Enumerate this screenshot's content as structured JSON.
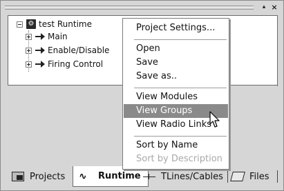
{
  "panel": {
    "pin_glyph": "▴",
    "close_glyph": "×"
  },
  "tree": {
    "root": {
      "label": "test Runtime",
      "icon": "runtime-root-icon",
      "expanded": true
    },
    "children": [
      {
        "label": "Main",
        "icon": "arrow-icon"
      },
      {
        "label": "Enable/Disable",
        "icon": "arrow-icon"
      },
      {
        "label": "Firing Control",
        "icon": "arrow-icon"
      }
    ]
  },
  "context_menu": {
    "items": [
      {
        "label": "Project Settings...",
        "enabled": true
      },
      {
        "label": "Open",
        "enabled": true
      },
      {
        "label": "Save",
        "enabled": true
      },
      {
        "label": "Save as..",
        "enabled": true
      },
      {
        "label": "View Modules",
        "enabled": true
      },
      {
        "label": "View Groups",
        "enabled": true,
        "hovered": true
      },
      {
        "label": "View Radio Links",
        "enabled": true
      },
      {
        "label": "Sort by Name",
        "enabled": true
      },
      {
        "label": "Sort by Description",
        "enabled": false
      }
    ]
  },
  "tabs": [
    {
      "label": "Projects",
      "icon": "projects-icon",
      "active": false
    },
    {
      "label": "Runtime",
      "icon": "runtime-icon",
      "active": true
    },
    {
      "label": "TLines/Cables",
      "icon": "tlines-icon",
      "active": false
    },
    {
      "label": "Files",
      "icon": "files-icon",
      "active": false
    }
  ],
  "colors": {
    "panel_bg": "#d6d6d6",
    "menu_highlight": "#8a8a8a",
    "disabled_text": "#a8a8a8"
  }
}
